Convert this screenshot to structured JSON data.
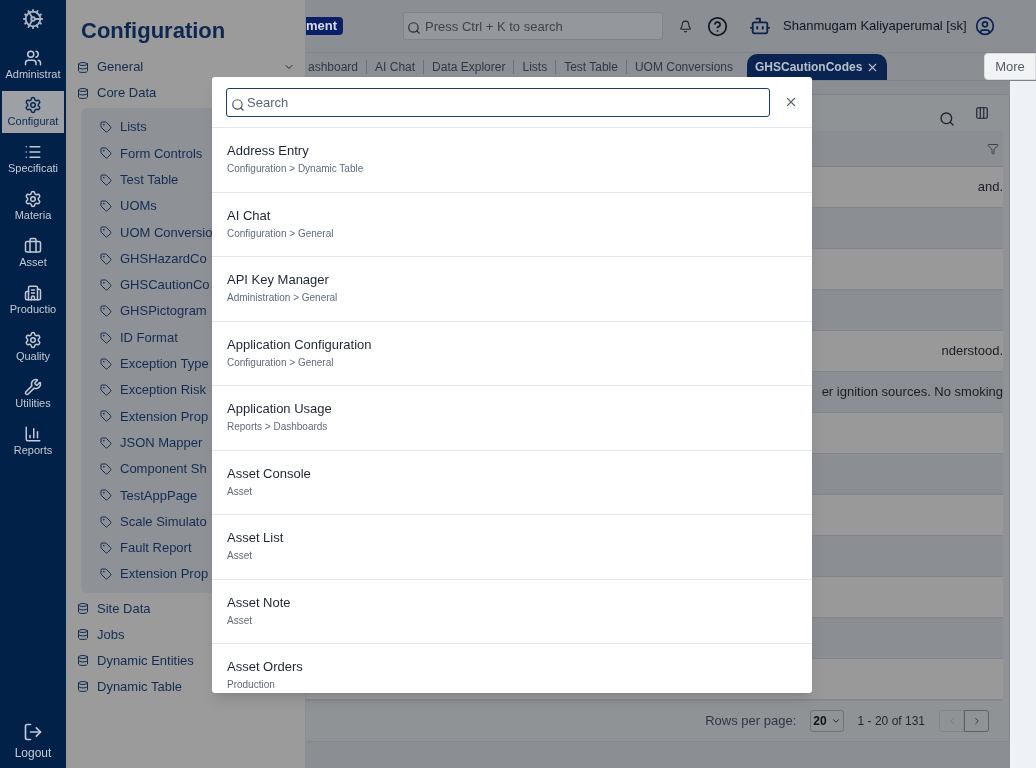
{
  "nav_rail": {
    "items": [
      {
        "label": "Administrat",
        "selected": false
      },
      {
        "label": "Configurat",
        "selected": true
      },
      {
        "label": "Specificati",
        "selected": false
      },
      {
        "label": "Materia",
        "selected": false
      },
      {
        "label": "Asset",
        "selected": false
      },
      {
        "label": "Productio",
        "selected": false
      },
      {
        "label": "Quality",
        "selected": false
      },
      {
        "label": "Utilities",
        "selected": false
      },
      {
        "label": "Reports",
        "selected": false
      }
    ],
    "logout": "Logout"
  },
  "config_panel": {
    "title": "Configuration",
    "groups": [
      {
        "label": "General",
        "kind": "dropdown"
      },
      {
        "label": "Core Data",
        "kind": "folder",
        "children": [
          "Lists",
          "Form Controls",
          "Test Table",
          "UOMs",
          "UOM Conversio",
          "GHSHazardCo",
          "GHSCautionCo",
          "GHSPictogram",
          "ID Format",
          "Exception Type",
          "Exception Risk",
          "Extension Prop",
          "JSON Mapper",
          "Component Sh",
          "TestAppPage",
          "Scale Simulato",
          "Fault Report",
          "Extension Prop"
        ]
      },
      {
        "label": "Site Data",
        "kind": "folder"
      },
      {
        "label": "Jobs",
        "kind": "folder"
      },
      {
        "label": "Dynamic Entities",
        "kind": "folder"
      },
      {
        "label": "Dynamic Table",
        "kind": "folder"
      }
    ]
  },
  "header": {
    "badge": "ment",
    "search_placeholder": "Press Ctrl + K to search",
    "user": "Shanmugam Kaliyaperumal [sk]"
  },
  "tabs": [
    {
      "label": "ashboard",
      "selected": false
    },
    {
      "label": "AI Chat",
      "selected": false
    },
    {
      "label": "Data Explorer",
      "selected": false
    },
    {
      "label": "Lists",
      "selected": false
    },
    {
      "label": "Test Table",
      "selected": false
    },
    {
      "label": "UOM Conversions",
      "selected": false
    },
    {
      "label": "GHSCautionCodes",
      "selected": true
    }
  ],
  "more_button": "More",
  "table": {
    "rows": [
      {
        "column_1": "and."
      },
      {},
      {},
      {},
      {
        "column_1": "nderstood."
      },
      {
        "column_1": "er ignition sources. No smoking"
      },
      {},
      {},
      {},
      {},
      {},
      {},
      {}
    ]
  },
  "pagination": {
    "label": "Rows per page:",
    "per_page": "20",
    "range": "1 - 20 of 131"
  },
  "search_dialog": {
    "placeholder": "Search",
    "results": [
      {
        "title": "Address Entry",
        "path": "Configuration > Dynamic Table"
      },
      {
        "title": "AI Chat",
        "path": "Configuration > General"
      },
      {
        "title": "API Key Manager",
        "path": "Administration > General"
      },
      {
        "title": "Application Configuration",
        "path": "Configuration > General"
      },
      {
        "title": "Application Usage",
        "path": "Reports > Dashboards"
      },
      {
        "title": "Asset Console",
        "path": "Asset"
      },
      {
        "title": "Asset List",
        "path": "Asset"
      },
      {
        "title": "Asset Note",
        "path": "Asset"
      },
      {
        "title": "Asset Orders",
        "path": "Production"
      }
    ]
  }
}
